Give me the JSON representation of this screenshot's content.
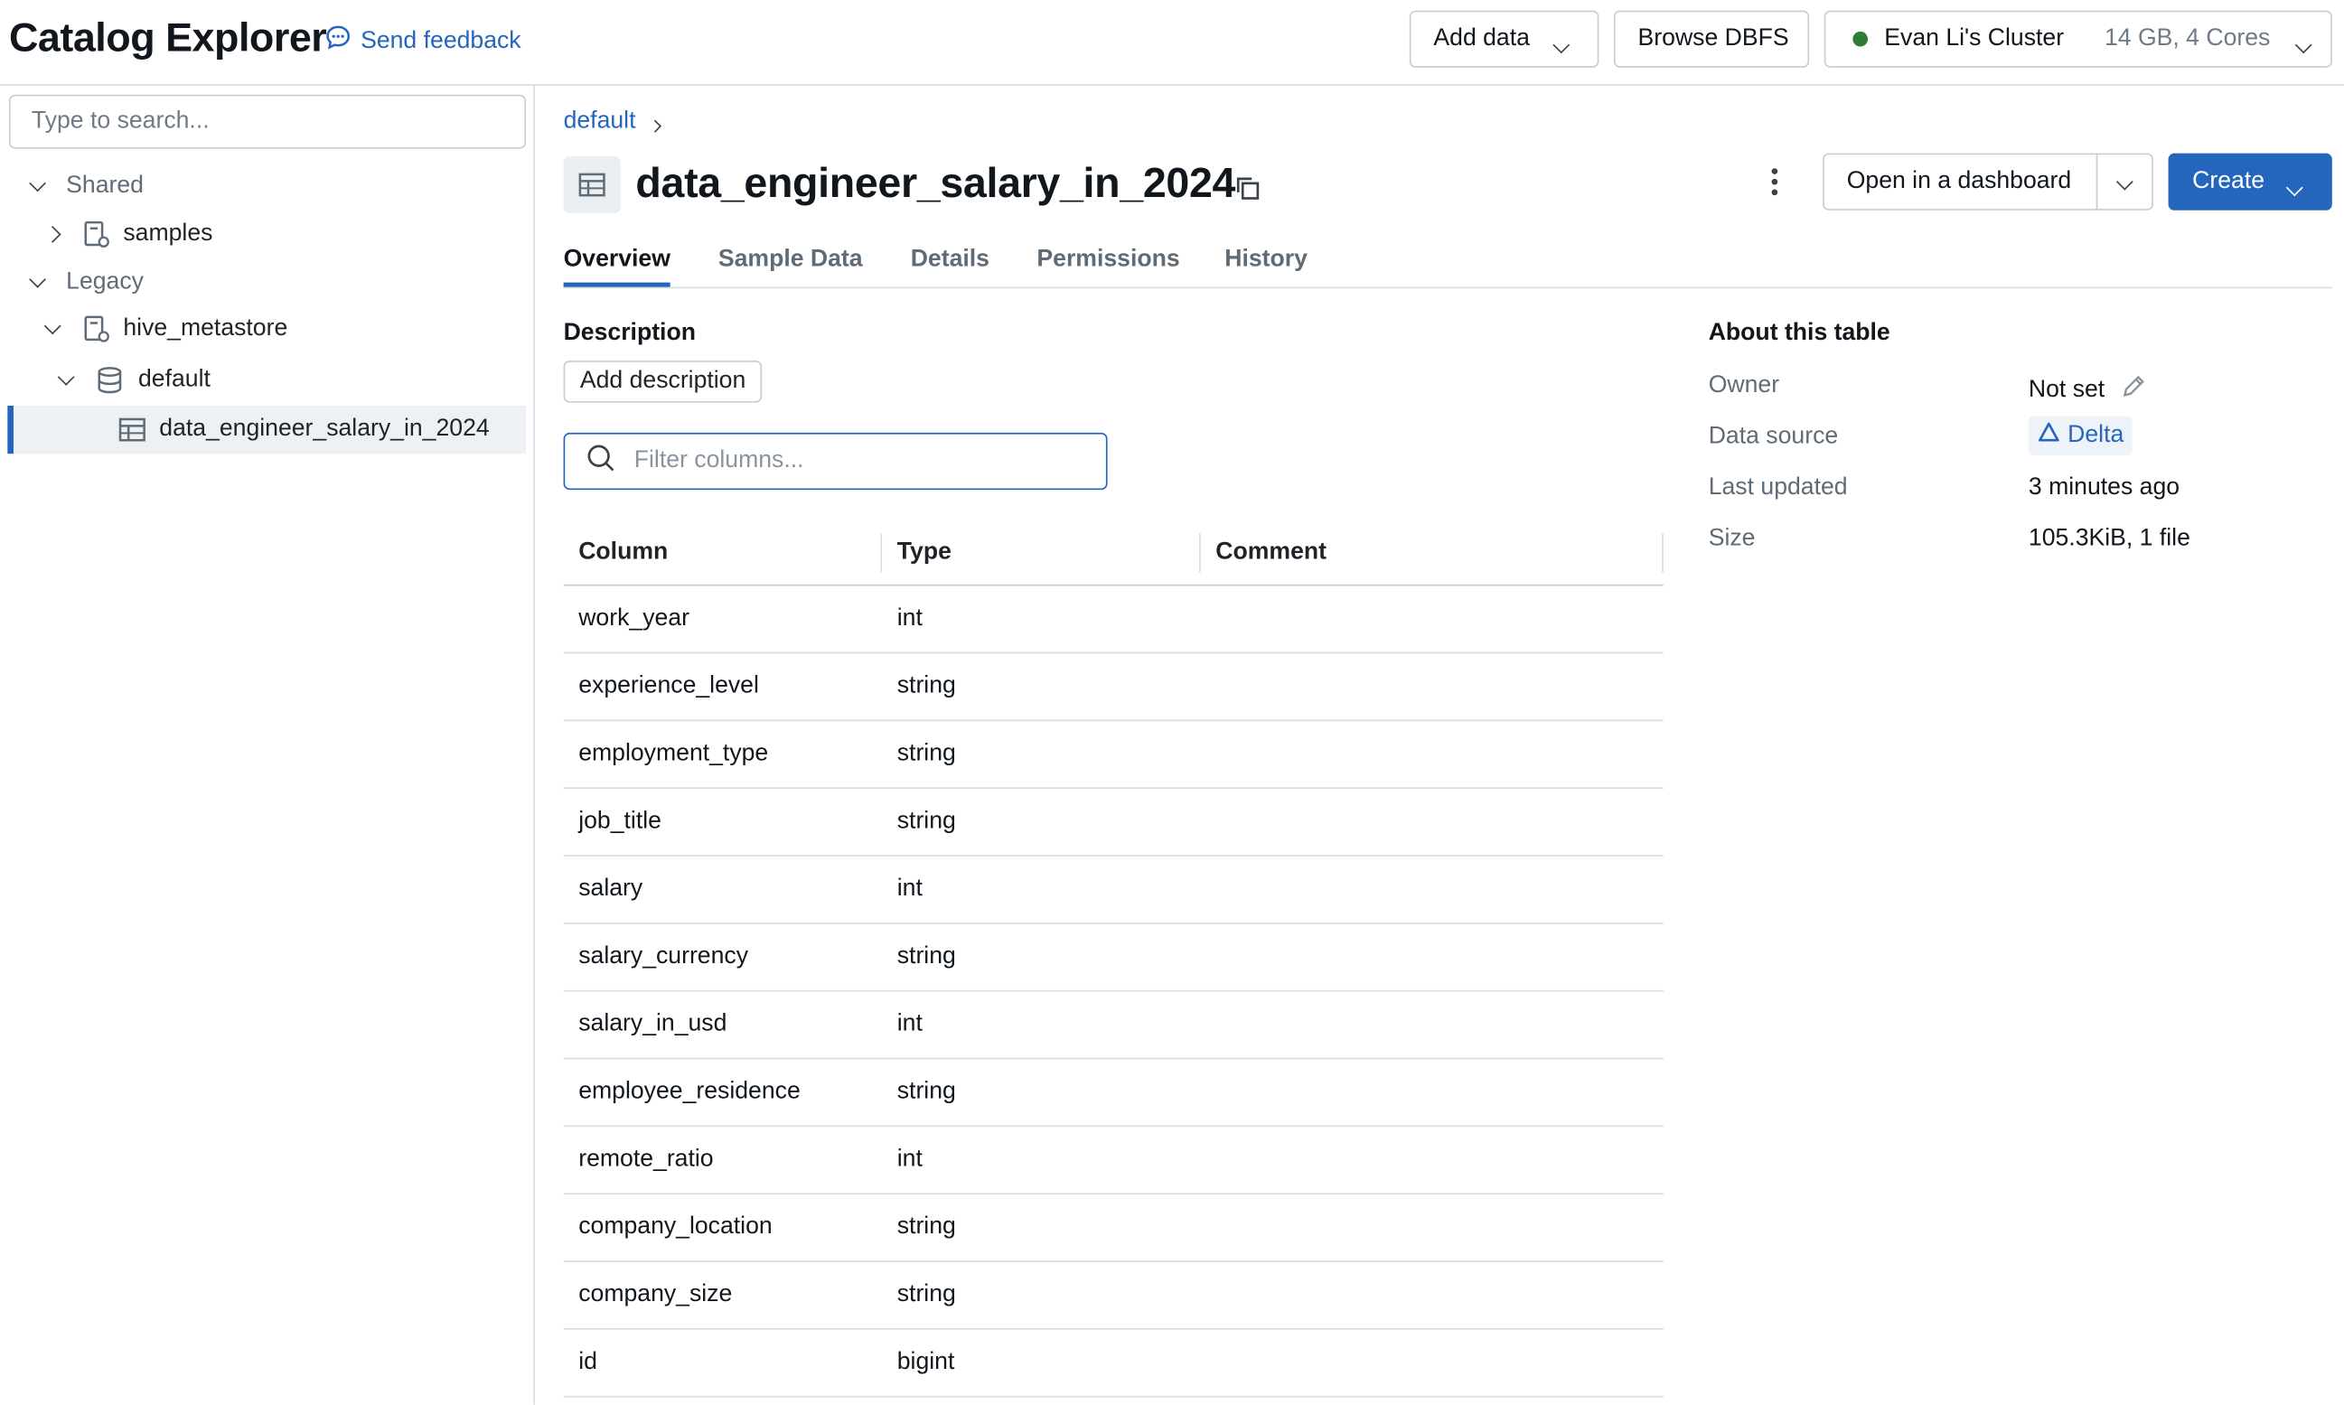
{
  "header": {
    "app_title": "Catalog Explorer",
    "feedback_label": "Send feedback",
    "add_data_label": "Add data",
    "browse_dbfs_label": "Browse DBFS",
    "cluster_name": "Evan Li's Cluster",
    "cluster_spec": "14 GB, 4 Cores",
    "cluster_status_color": "#2e7d32"
  },
  "sidebar": {
    "search_placeholder": "Type to search...",
    "tree": [
      {
        "label": "Shared",
        "kind": "section",
        "expanded": true
      },
      {
        "label": "samples",
        "kind": "catalog",
        "expanded": false
      },
      {
        "label": "Legacy",
        "kind": "section",
        "expanded": true
      },
      {
        "label": "hive_metastore",
        "kind": "catalog",
        "expanded": true
      },
      {
        "label": "default",
        "kind": "schema",
        "expanded": true
      },
      {
        "label": "data_engineer_salary_in_2024",
        "kind": "table",
        "selected": true
      }
    ]
  },
  "main": {
    "breadcrumb": "default",
    "title": "data_engineer_salary_in_2024",
    "open_dashboard_label": "Open in a dashboard",
    "create_label": "Create",
    "tabs": [
      {
        "label": "Overview",
        "active": true
      },
      {
        "label": "Sample Data",
        "active": false
      },
      {
        "label": "Details",
        "active": false
      },
      {
        "label": "Permissions",
        "active": false
      },
      {
        "label": "History",
        "active": false
      }
    ],
    "description_heading": "Description",
    "add_description_label": "Add description",
    "filter_placeholder": "Filter columns...",
    "columns_table": {
      "headers": [
        "Column",
        "Type",
        "Comment"
      ],
      "rows": [
        [
          "work_year",
          "int",
          ""
        ],
        [
          "experience_level",
          "string",
          ""
        ],
        [
          "employment_type",
          "string",
          ""
        ],
        [
          "job_title",
          "string",
          ""
        ],
        [
          "salary",
          "int",
          ""
        ],
        [
          "salary_currency",
          "string",
          ""
        ],
        [
          "salary_in_usd",
          "int",
          ""
        ],
        [
          "employee_residence",
          "string",
          ""
        ],
        [
          "remote_ratio",
          "int",
          ""
        ],
        [
          "company_location",
          "string",
          ""
        ],
        [
          "company_size",
          "string",
          ""
        ],
        [
          "id",
          "bigint",
          ""
        ]
      ]
    },
    "about": {
      "heading": "About this table",
      "owner_label": "Owner",
      "owner_value": "Not set",
      "data_source_label": "Data source",
      "data_source_value": "Delta",
      "last_updated_label": "Last updated",
      "last_updated_value": "3 minutes ago",
      "size_label": "Size",
      "size_value": "105.3KiB, 1 file"
    }
  },
  "colors": {
    "accent": "#2566bd",
    "border": "#d8dde3",
    "text": "#11171c",
    "muted_text": "#5f6b76"
  }
}
